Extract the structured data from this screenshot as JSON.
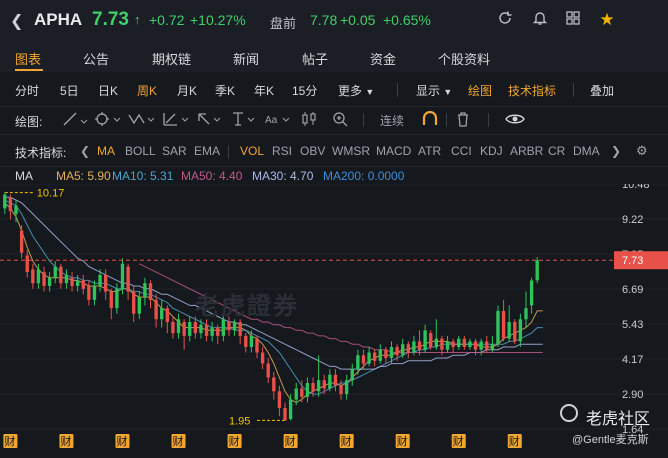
{
  "header": {
    "back_icon": "back-arrow-icon",
    "symbol": "APHA",
    "price": "7.73",
    "change": "+0.72",
    "change_pct": "+10.27%",
    "premarket_label": "盘前",
    "premarket_price": "7.78",
    "premarket_change": "+0.05",
    "premarket_pct": "+0.65%",
    "icons": [
      "refresh-icon",
      "bell-icon",
      "grid-icon",
      "star-icon"
    ],
    "up_color": "#3fcf6b",
    "accent_color": "#f0a632"
  },
  "tabs": [
    "图表",
    "公告",
    "期权链",
    "新闻",
    "帖子",
    "资金",
    "个股资料"
  ],
  "periods": {
    "items": [
      "分时",
      "5日",
      "日K",
      "周K",
      "月K",
      "季K",
      "年K",
      "15分",
      "更多"
    ],
    "active": "周K",
    "display": "显示",
    "draw": "绘图",
    "tech": "技术指标",
    "overlay": "叠加"
  },
  "drawbar": {
    "label": "绘图:",
    "continuous": "连续"
  },
  "indicators": {
    "label": "技术指标:",
    "items": [
      "MA",
      "BOLL",
      "SAR",
      "EMA",
      "VOL",
      "RSI",
      "OBV",
      "WMSR",
      "MACD",
      "ATR",
      "CCI",
      "KDJ",
      "ARBR",
      "CR",
      "DMA"
    ],
    "active": [
      "MA",
      "VOL"
    ]
  },
  "legend": {
    "title": "MA",
    "ma5": "MA5: 5.90",
    "ma10": "MA10: 5.31",
    "ma50": "MA50: 4.40",
    "ma30": "MA30: 4.70",
    "ma200": "MA200: 0.0000"
  },
  "chart_data": {
    "type": "candlestick",
    "y_ticks": [
      "10.48",
      "9.22",
      "7.95",
      "6.69",
      "5.43",
      "4.17",
      "2.90",
      "1.64"
    ],
    "ylim": [
      1.64,
      10.48
    ],
    "current_price_label": "7.73",
    "high_label": "10.17",
    "low_label": "1.95",
    "earnings_marker": "财",
    "earnings_marker_count": 10,
    "candles": [
      {
        "o": 9.6,
        "c": 10.1,
        "h": 10.17,
        "l": 9.4
      },
      {
        "o": 10.0,
        "c": 9.5,
        "h": 10.1,
        "l": 9.2
      },
      {
        "o": 9.4,
        "c": 9.7,
        "h": 9.9,
        "l": 9.1
      },
      {
        "o": 8.8,
        "c": 8.0,
        "h": 9.0,
        "l": 7.8
      },
      {
        "o": 7.9,
        "c": 7.3,
        "h": 8.1,
        "l": 7.1
      },
      {
        "o": 7.4,
        "c": 6.9,
        "h": 7.6,
        "l": 6.7
      },
      {
        "o": 6.9,
        "c": 7.4,
        "h": 7.6,
        "l": 6.7
      },
      {
        "o": 7.3,
        "c": 6.8,
        "h": 7.5,
        "l": 6.6
      },
      {
        "o": 6.8,
        "c": 7.1,
        "h": 7.3,
        "l": 6.6
      },
      {
        "o": 7.1,
        "c": 7.5,
        "h": 7.7,
        "l": 6.9
      },
      {
        "o": 7.5,
        "c": 6.9,
        "h": 7.6,
        "l": 6.7
      },
      {
        "o": 6.9,
        "c": 7.2,
        "h": 7.4,
        "l": 6.7
      },
      {
        "o": 7.1,
        "c": 6.8,
        "h": 7.3,
        "l": 6.6
      },
      {
        "o": 6.8,
        "c": 7.0,
        "h": 7.2,
        "l": 6.6
      },
      {
        "o": 7.0,
        "c": 6.7,
        "h": 7.2,
        "l": 6.5
      },
      {
        "o": 6.8,
        "c": 6.3,
        "h": 7.0,
        "l": 6.1
      },
      {
        "o": 6.3,
        "c": 6.8,
        "h": 7.0,
        "l": 6.1
      },
      {
        "o": 6.8,
        "c": 7.2,
        "h": 7.4,
        "l": 6.6
      },
      {
        "o": 7.2,
        "c": 6.6,
        "h": 7.4,
        "l": 6.3
      },
      {
        "o": 6.6,
        "c": 6.0,
        "h": 6.7,
        "l": 5.6
      },
      {
        "o": 6.0,
        "c": 6.7,
        "h": 6.9,
        "l": 5.8
      },
      {
        "o": 6.7,
        "c": 7.6,
        "h": 7.8,
        "l": 6.5
      },
      {
        "o": 7.5,
        "c": 6.6,
        "h": 7.6,
        "l": 6.3
      },
      {
        "o": 6.6,
        "c": 5.8,
        "h": 6.8,
        "l": 5.5
      },
      {
        "o": 5.8,
        "c": 6.4,
        "h": 6.6,
        "l": 5.6
      },
      {
        "o": 6.4,
        "c": 6.9,
        "h": 7.1,
        "l": 6.1
      },
      {
        "o": 6.9,
        "c": 6.3,
        "h": 7.0,
        "l": 6.0
      },
      {
        "o": 6.3,
        "c": 5.6,
        "h": 6.5,
        "l": 5.3
      },
      {
        "o": 5.6,
        "c": 6.0,
        "h": 6.3,
        "l": 5.3
      },
      {
        "o": 6.0,
        "c": 5.5,
        "h": 6.1,
        "l": 5.1
      },
      {
        "o": 5.5,
        "c": 5.1,
        "h": 5.7,
        "l": 4.9
      },
      {
        "o": 5.1,
        "c": 5.6,
        "h": 5.8,
        "l": 4.9
      },
      {
        "o": 5.5,
        "c": 5.0,
        "h": 5.6,
        "l": 4.5
      },
      {
        "o": 5.0,
        "c": 5.5,
        "h": 5.7,
        "l": 4.8
      },
      {
        "o": 5.5,
        "c": 5.1,
        "h": 5.7,
        "l": 4.9
      },
      {
        "o": 5.1,
        "c": 5.4,
        "h": 5.6,
        "l": 4.9
      },
      {
        "o": 5.4,
        "c": 5.0,
        "h": 5.6,
        "l": 4.8
      },
      {
        "o": 5.0,
        "c": 5.3,
        "h": 5.5,
        "l": 4.8
      },
      {
        "o": 5.3,
        "c": 5.0,
        "h": 5.4,
        "l": 4.7
      },
      {
        "o": 5.0,
        "c": 5.6,
        "h": 5.8,
        "l": 4.8
      },
      {
        "o": 5.5,
        "c": 5.2,
        "h": 5.7,
        "l": 5.0
      },
      {
        "o": 5.2,
        "c": 5.5,
        "h": 5.6,
        "l": 5.0
      },
      {
        "o": 5.5,
        "c": 5.0,
        "h": 5.6,
        "l": 4.7
      },
      {
        "o": 5.0,
        "c": 4.6,
        "h": 5.1,
        "l": 4.4
      },
      {
        "o": 4.6,
        "c": 5.0,
        "h": 5.2,
        "l": 4.4
      },
      {
        "o": 4.9,
        "c": 4.4,
        "h": 5.0,
        "l": 4.2
      },
      {
        "o": 4.4,
        "c": 4.0,
        "h": 4.6,
        "l": 3.8
      },
      {
        "o": 4.0,
        "c": 3.5,
        "h": 4.2,
        "l": 3.3
      },
      {
        "o": 3.5,
        "c": 3.0,
        "h": 3.7,
        "l": 2.7
      },
      {
        "o": 3.0,
        "c": 2.4,
        "h": 3.2,
        "l": 2.1
      },
      {
        "o": 2.4,
        "c": 1.95,
        "h": 2.6,
        "l": 1.95
      },
      {
        "o": 2.0,
        "c": 2.7,
        "h": 2.9,
        "l": 1.95
      },
      {
        "o": 2.7,
        "c": 3.1,
        "h": 3.3,
        "l": 2.5
      },
      {
        "o": 3.1,
        "c": 2.8,
        "h": 3.4,
        "l": 2.6
      },
      {
        "o": 2.8,
        "c": 3.3,
        "h": 3.5,
        "l": 2.6
      },
      {
        "o": 3.3,
        "c": 3.0,
        "h": 3.5,
        "l": 2.8
      },
      {
        "o": 3.0,
        "c": 3.4,
        "h": 4.3,
        "l": 2.8
      },
      {
        "o": 3.4,
        "c": 3.1,
        "h": 3.6,
        "l": 2.9
      },
      {
        "o": 3.1,
        "c": 3.6,
        "h": 3.8,
        "l": 3.0
      },
      {
        "o": 3.6,
        "c": 3.2,
        "h": 3.8,
        "l": 3.0
      },
      {
        "o": 3.2,
        "c": 2.9,
        "h": 3.4,
        "l": 2.7
      },
      {
        "o": 2.9,
        "c": 3.4,
        "h": 3.6,
        "l": 2.7
      },
      {
        "o": 3.4,
        "c": 3.8,
        "h": 4.0,
        "l": 3.2
      },
      {
        "o": 3.8,
        "c": 4.3,
        "h": 4.5,
        "l": 3.6
      },
      {
        "o": 4.3,
        "c": 4.0,
        "h": 4.5,
        "l": 3.8
      },
      {
        "o": 4.0,
        "c": 4.4,
        "h": 4.6,
        "l": 3.9
      },
      {
        "o": 4.4,
        "c": 4.1,
        "h": 4.5,
        "l": 3.9
      },
      {
        "o": 4.1,
        "c": 4.5,
        "h": 4.7,
        "l": 4.0
      },
      {
        "o": 4.5,
        "c": 4.2,
        "h": 4.6,
        "l": 4.0
      },
      {
        "o": 4.2,
        "c": 4.6,
        "h": 4.8,
        "l": 4.0
      },
      {
        "o": 4.6,
        "c": 4.3,
        "h": 4.7,
        "l": 4.1
      },
      {
        "o": 4.3,
        "c": 4.7,
        "h": 4.9,
        "l": 4.2
      },
      {
        "o": 4.7,
        "c": 4.4,
        "h": 4.8,
        "l": 4.2
      },
      {
        "o": 4.4,
        "c": 4.8,
        "h": 5.0,
        "l": 4.3
      },
      {
        "o": 4.8,
        "c": 4.5,
        "h": 5.2,
        "l": 4.3
      },
      {
        "o": 4.5,
        "c": 5.2,
        "h": 5.4,
        "l": 4.4
      },
      {
        "o": 5.1,
        "c": 4.6,
        "h": 5.2,
        "l": 4.5
      },
      {
        "o": 4.6,
        "c": 4.9,
        "h": 5.6,
        "l": 4.5
      },
      {
        "o": 4.9,
        "c": 4.5,
        "h": 5.0,
        "l": 4.3
      },
      {
        "o": 4.5,
        "c": 4.8,
        "h": 5.0,
        "l": 4.4
      },
      {
        "o": 4.8,
        "c": 4.6,
        "h": 4.9,
        "l": 4.4
      },
      {
        "o": 4.6,
        "c": 4.9,
        "h": 5.0,
        "l": 4.5
      },
      {
        "o": 4.9,
        "c": 4.6,
        "h": 5.0,
        "l": 4.5
      },
      {
        "o": 4.6,
        "c": 4.8,
        "h": 4.9,
        "l": 4.5
      },
      {
        "o": 4.8,
        "c": 4.5,
        "h": 4.9,
        "l": 4.3
      },
      {
        "o": 4.5,
        "c": 4.8,
        "h": 4.9,
        "l": 4.3
      },
      {
        "o": 4.8,
        "c": 4.5,
        "h": 5.0,
        "l": 4.4
      },
      {
        "o": 4.5,
        "c": 4.7,
        "h": 5.0,
        "l": 4.4
      },
      {
        "o": 4.7,
        "c": 5.9,
        "h": 6.1,
        "l": 4.6
      },
      {
        "o": 5.9,
        "c": 4.9,
        "h": 6.3,
        "l": 4.8
      },
      {
        "o": 4.9,
        "c": 5.5,
        "h": 6.1,
        "l": 4.8
      },
      {
        "o": 5.5,
        "c": 4.8,
        "h": 5.6,
        "l": 4.7
      },
      {
        "o": 4.8,
        "c": 5.6,
        "h": 5.8,
        "l": 4.6
      },
      {
        "o": 5.6,
        "c": 6.0,
        "h": 6.6,
        "l": 5.3
      },
      {
        "o": 6.1,
        "c": 7.0,
        "h": 7.1,
        "l": 5.8
      },
      {
        "o": 7.01,
        "c": 7.73,
        "h": 7.85,
        "l": 6.9
      }
    ],
    "ma_series": {
      "ma5": [
        9.8,
        9.6,
        9.3,
        8.8,
        8.2,
        7.7,
        7.4,
        7.2,
        7.1,
        7.1,
        7.1,
        7.1,
        7.0,
        7.0,
        6.9,
        6.8,
        6.8,
        6.8,
        6.7,
        6.6,
        6.6,
        6.7,
        6.7,
        6.5,
        6.4,
        6.4,
        6.4,
        6.2,
        6.0,
        5.9,
        5.7,
        5.5,
        5.3,
        5.3,
        5.3,
        5.3,
        5.2,
        5.2,
        5.2,
        5.2,
        5.3,
        5.3,
        5.3,
        5.2,
        5.0,
        4.9,
        4.7,
        4.4,
        4.0,
        3.5,
        3.0,
        2.7,
        2.6,
        2.7,
        2.9,
        3.0,
        3.1,
        3.2,
        3.3,
        3.3,
        3.2,
        3.3,
        3.5,
        3.7,
        3.9,
        4.1,
        4.2,
        4.3,
        4.3,
        4.3,
        4.4,
        4.5,
        4.5,
        4.6,
        4.6,
        4.7,
        4.8,
        4.8,
        4.8,
        4.8,
        4.7,
        4.7,
        4.7,
        4.7,
        4.7,
        4.6,
        4.6,
        4.6,
        4.7,
        4.9,
        5.0,
        5.1,
        5.2,
        5.3,
        5.5,
        5.9,
        5.9
      ],
      "ma10": [
        9.9,
        9.8,
        9.7,
        9.4,
        9.0,
        8.6,
        8.3,
        8.0,
        7.7,
        7.5,
        7.3,
        7.2,
        7.1,
        7.1,
        7.0,
        7.0,
        6.9,
        6.9,
        6.9,
        6.8,
        6.7,
        6.7,
        6.7,
        6.6,
        6.6,
        6.5,
        6.5,
        6.4,
        6.3,
        6.2,
        6.0,
        5.9,
        5.8,
        5.7,
        5.6,
        5.5,
        5.4,
        5.3,
        5.3,
        5.3,
        5.3,
        5.2,
        5.2,
        5.2,
        5.1,
        5.0,
        4.9,
        4.8,
        4.6,
        4.4,
        4.1,
        3.8,
        3.5,
        3.2,
        3.0,
        2.9,
        2.9,
        3.0,
        3.1,
        3.2,
        3.3,
        3.3,
        3.4,
        3.5,
        3.6,
        3.7,
        3.8,
        3.9,
        4.0,
        4.1,
        4.2,
        4.3,
        4.4,
        4.4,
        4.5,
        4.5,
        4.6,
        4.6,
        4.7,
        4.7,
        4.7,
        4.7,
        4.7,
        4.7,
        4.7,
        4.7,
        4.7,
        4.7,
        4.7,
        4.7,
        4.8,
        4.8,
        4.9,
        5.0,
        5.1,
        5.3,
        5.3
      ],
      "ma30": [
        10.0,
        10.0,
        9.9,
        9.8,
        9.6,
        9.4,
        9.2,
        9.0,
        8.8,
        8.6,
        8.4,
        8.2,
        8.0,
        7.8,
        7.7,
        7.5,
        7.4,
        7.3,
        7.2,
        7.1,
        7.0,
        6.9,
        6.9,
        6.8,
        6.8,
        6.7,
        6.7,
        6.6,
        6.5,
        6.5,
        6.4,
        6.3,
        6.2,
        6.1,
        6.1,
        6.0,
        5.9,
        5.8,
        5.7,
        5.6,
        5.5,
        5.5,
        5.4,
        5.4,
        5.3,
        5.2,
        5.1,
        5.0,
        4.9,
        4.8,
        4.7,
        4.6,
        4.5,
        4.4,
        4.3,
        4.2,
        4.1,
        4.0,
        3.9,
        3.9,
        3.8,
        3.8,
        3.8,
        3.8,
        3.8,
        3.8,
        3.8,
        3.9,
        3.9,
        4.0,
        4.0,
        4.0,
        4.1,
        4.1,
        4.1,
        4.1,
        4.1,
        4.2,
        4.2,
        4.2,
        4.3,
        4.3,
        4.3,
        4.4,
        4.4,
        4.4,
        4.5,
        4.5,
        4.5,
        4.6,
        4.6,
        4.6,
        4.7,
        4.7,
        4.7,
        4.7,
        4.7
      ],
      "ma50": [
        null,
        null,
        null,
        null,
        null,
        null,
        null,
        null,
        null,
        null,
        null,
        null,
        null,
        null,
        null,
        null,
        null,
        null,
        null,
        null,
        null,
        null,
        null,
        null,
        7.6,
        7.5,
        7.4,
        7.3,
        7.2,
        7.1,
        7.0,
        6.9,
        6.8,
        6.7,
        6.6,
        6.5,
        6.4,
        6.3,
        6.2,
        6.1,
        6.0,
        5.9,
        5.8,
        5.7,
        5.6,
        5.6,
        5.5,
        5.5,
        5.4,
        5.4,
        5.3,
        5.3,
        5.2,
        5.2,
        5.1,
        5.1,
        5.0,
        5.0,
        4.9,
        4.9,
        4.8,
        4.8,
        4.7,
        4.7,
        4.6,
        4.6,
        4.5,
        4.5,
        4.5,
        4.4,
        4.4,
        4.4,
        4.4,
        4.4,
        4.4,
        4.4,
        4.4,
        4.4,
        4.4,
        4.4,
        4.4,
        4.4,
        4.4,
        4.4,
        4.4,
        4.4,
        4.4,
        4.4,
        4.4,
        4.4,
        4.4,
        4.4,
        4.4,
        4.4,
        4.4,
        4.4,
        4.4
      ]
    }
  },
  "watermark": "老虎證券",
  "brand": "老虎社区",
  "brand_user": "@Gentle麦克斯"
}
